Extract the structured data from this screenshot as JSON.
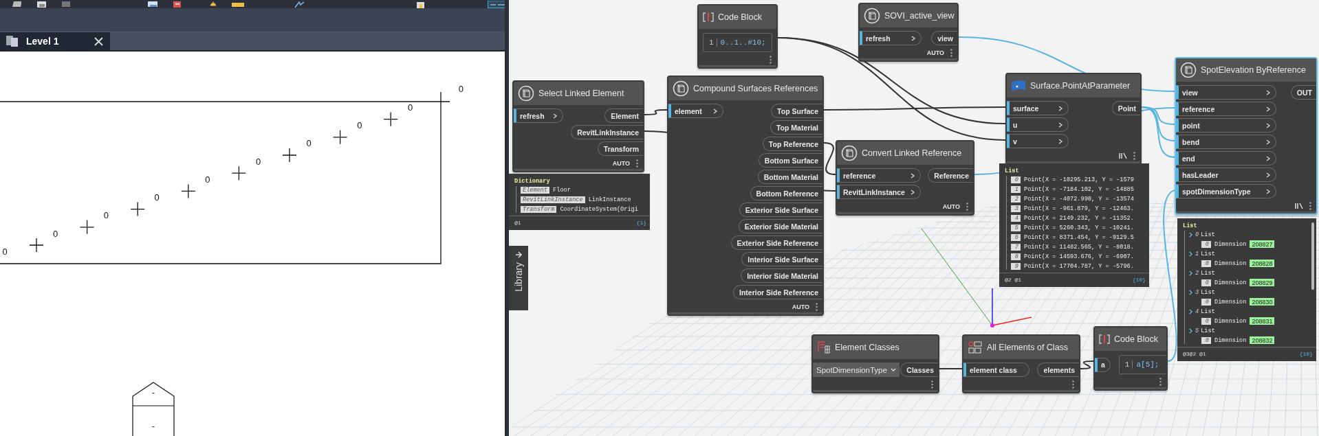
{
  "revit_view": {
    "tab": {
      "label": "Level 1",
      "selected": true
    },
    "drawing": {
      "spot_labels": [
        "0",
        "0",
        "0",
        "0",
        "0",
        "0",
        "0",
        "0",
        "0",
        "0"
      ],
      "tag_labels": [
        "-",
        "-"
      ]
    }
  },
  "library_tab": {
    "label": "Library"
  },
  "nodes": [
    {
      "kind": "code_block",
      "title": "Code Block",
      "selected": false,
      "lacing": false,
      "line": "1",
      "code": "0..1..#10;"
    },
    {
      "kind": "custom_node",
      "title": "SOVI_active_view",
      "selected": false,
      "lacing": false,
      "run_mode": "AUTO",
      "inputs": [
        "refresh"
      ],
      "outputs": [
        "view"
      ]
    },
    {
      "kind": "custom_node",
      "title": "Select Linked Element",
      "selected": false,
      "lacing": false,
      "run_mode": "AUTO",
      "inputs": [
        "refresh"
      ],
      "outputs": [
        "Element",
        "RevitLinkInstance",
        "Transform"
      ]
    },
    {
      "kind": "custom_node",
      "title": "Compound Surfaces References",
      "selected": false,
      "lacing": false,
      "run_mode": "AUTO",
      "inputs": [
        "element"
      ],
      "outputs": [
        "Top Surface",
        "Top Material",
        "Top Reference",
        "Bottom Surface",
        "Bottom Material",
        "Bottom Reference",
        "Exterior Side Surface",
        "Exterior Side Material",
        "Exterior Side Reference",
        "Interior Side Surface",
        "Interior Side Material",
        "Interior Side Reference"
      ]
    },
    {
      "kind": "geometry_node",
      "title": "Surface.PointAtParameter",
      "selected": false,
      "lacing": true,
      "inputs": [
        "surface",
        "u",
        "v"
      ],
      "outputs": [
        "Point"
      ]
    },
    {
      "kind": "custom_node",
      "title": "Convert Linked Reference",
      "selected": false,
      "lacing": false,
      "run_mode": "AUTO",
      "inputs": [
        "reference",
        "RevitLinkInstance"
      ],
      "outputs": [
        "Reference"
      ]
    },
    {
      "kind": "custom_node",
      "title": "SpotElevation ByReference",
      "selected": true,
      "lacing": true,
      "inputs": [
        "view",
        "reference",
        "point",
        "bend",
        "end",
        "hasLeader",
        "spotDimensionType"
      ],
      "outputs": [
        "OUT"
      ]
    },
    {
      "kind": "dropdown_node",
      "title": "Element Classes",
      "selected": false,
      "lacing": false,
      "value": "SpotDimensionType",
      "outputs": [
        "Classes"
      ]
    },
    {
      "kind": "query_node",
      "title": "All Elements of Class",
      "selected": false,
      "lacing": false,
      "inputs": [
        "element class"
      ],
      "outputs": [
        "elements"
      ]
    },
    {
      "kind": "code_block",
      "title": "Code Block",
      "selected": false,
      "lacing": false,
      "line": "1",
      "code": "a[5];",
      "inputs": [
        "a"
      ]
    }
  ],
  "previews": [
    {
      "kind": "dictionary",
      "title": "Dictionary",
      "levels": "@1",
      "count": "{1}",
      "entries": [
        {
          "key": "Element",
          "value": "Floor"
        },
        {
          "key": "RevitLinkInstance",
          "value": "LinkInstance"
        },
        {
          "key": "Transform",
          "value": "CoordinateSystem(Origi"
        }
      ]
    },
    {
      "kind": "list",
      "title": "List",
      "levels": "@2 @1",
      "count": "{10}",
      "items": [
        {
          "index": "0",
          "value": "Point(X = -10295.213, Y = -1579"
        },
        {
          "index": "1",
          "value": "Point(X = -7184.102, Y = -14885"
        },
        {
          "index": "2",
          "value": "Point(X = -4072.990, Y = -13574"
        },
        {
          "index": "3",
          "value": "Point(X = -961.879, Y = -12463."
        },
        {
          "index": "4",
          "value": "Point(X = 2149.232, Y = -11352."
        },
        {
          "index": "5",
          "value": "Point(X = 5260.343, Y = -10241."
        },
        {
          "index": "6",
          "value": "Point(X = 8371.454, Y = -9129.5"
        },
        {
          "index": "7",
          "value": "Point(X = 11482.565, Y = -8018."
        },
        {
          "index": "8",
          "value": "Point(X = 14593.676, Y = -6907."
        },
        {
          "index": "9",
          "value": "Point(X = 17704.787, Y = -5796."
        }
      ]
    },
    {
      "kind": "nested_list",
      "title": "List",
      "levels": "@3@2 @1",
      "count": "{10}",
      "groups": [
        {
          "index": "0",
          "title": "List",
          "items": [
            {
              "index": "0",
              "type": "Dimension",
              "id": "208827"
            }
          ]
        },
        {
          "index": "1",
          "title": "List",
          "items": [
            {
              "index": "0",
              "type": "Dimension",
              "id": "208828"
            }
          ]
        },
        {
          "index": "2",
          "title": "List",
          "items": [
            {
              "index": "0",
              "type": "Dimension",
              "id": "208829"
            }
          ]
        },
        {
          "index": "3",
          "title": "List",
          "items": [
            {
              "index": "0",
              "type": "Dimension",
              "id": "208830"
            }
          ]
        },
        {
          "index": "4",
          "title": "List",
          "items": [
            {
              "index": "0",
              "type": "Dimension",
              "id": "208831"
            }
          ]
        },
        {
          "index": "5",
          "title": "List",
          "items": [
            {
              "index": "0",
              "type": "Dimension",
              "id": "208832"
            }
          ]
        }
      ]
    }
  ]
}
